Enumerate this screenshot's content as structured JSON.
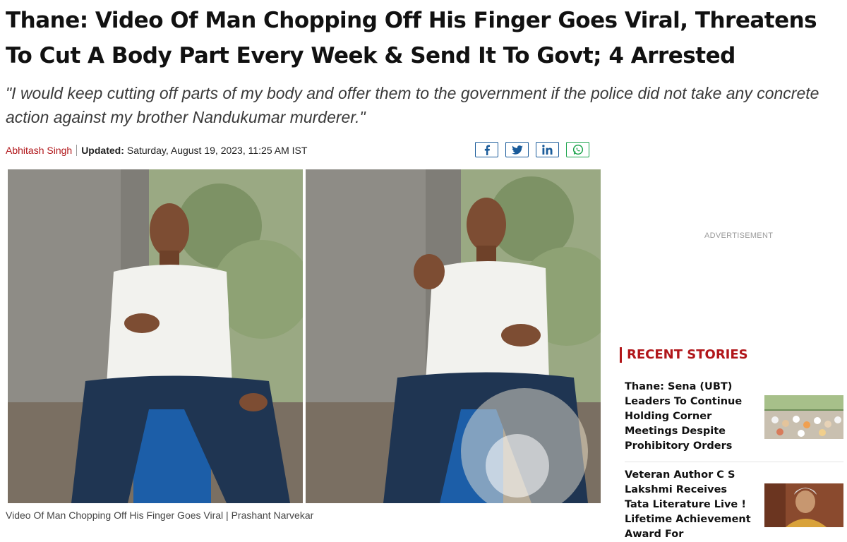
{
  "article": {
    "headline": "Thane: Video Of Man Chopping Off His Finger Goes Viral, Threatens To Cut A Body Part Every Week & Send It To Govt; 4 Arrested",
    "quote": "\"I would keep cutting off parts of my body and offer them to the government if the police did not take any concrete action against my brother Nandukumar murderer.\"",
    "author": "Abhitash Singh",
    "updated_label": "Updated:",
    "updated_value": "Saturday, August 19, 2023, 11:25 AM IST",
    "caption": "Video Of Man Chopping Off His Finger Goes Viral | Prashant Narvekar"
  },
  "share": [
    {
      "icon": "facebook-icon",
      "glyph": "f"
    },
    {
      "icon": "twitter-icon",
      "glyph": "t"
    },
    {
      "icon": "linkedin-icon",
      "glyph": "in"
    },
    {
      "icon": "whatsapp-icon",
      "glyph": "w"
    }
  ],
  "sidebar": {
    "ad_label": "ADVERTISEMENT",
    "recent_title": "RECENT STORIES",
    "stories": [
      {
        "title": "Thane: Sena (UBT) Leaders To Continue Holding Corner Meetings Despite Prohibitory Orders"
      },
      {
        "title": "Veteran Author C S Lakshmi Receives Tata Literature Live ! Lifetime Achievement Award For"
      }
    ]
  },
  "colors": {
    "accent": "#b1161a",
    "share_blue": "#1a5b9a",
    "whatsapp_green": "#1aa34a"
  }
}
